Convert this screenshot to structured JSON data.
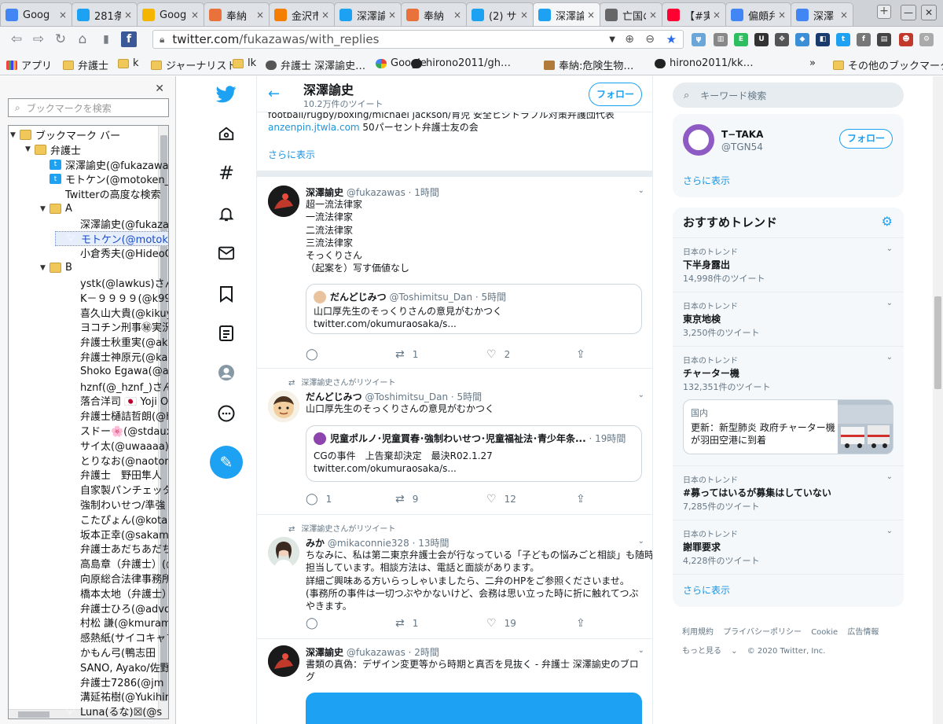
{
  "browser": {
    "tabs": [
      {
        "label": "Goog",
        "icon": "gmail-icon",
        "color": "#4285f4"
      },
      {
        "label": "281条",
        "icon": "twitter-icon",
        "color": "#1da1f2"
      },
      {
        "label": "Goog",
        "icon": "keep-icon",
        "color": "#f4b400"
      },
      {
        "label": "奉納",
        "icon": "blog-icon",
        "color": "#e8713c"
      },
      {
        "label": "金沢市",
        "icon": "blogger-icon",
        "color": "#f57d00"
      },
      {
        "label": "深澤諭",
        "icon": "twitter-icon",
        "color": "#1da1f2"
      },
      {
        "label": "奉納",
        "icon": "blog-icon",
        "color": "#e8713c"
      },
      {
        "label": "(2) サ",
        "icon": "twitter-icon",
        "color": "#1da1f2"
      },
      {
        "label": "深澤論",
        "icon": "twitter-icon",
        "color": "#1da1f2"
      },
      {
        "label": "亡国の",
        "icon": "globe-icon",
        "color": "#666666"
      },
      {
        "label": "【#実",
        "icon": "yahoo-icon",
        "color": "#ff0033"
      },
      {
        "label": "偏頗弁",
        "icon": "google-icon",
        "color": "#4285f4"
      },
      {
        "label": "深澤",
        "icon": "google-icon",
        "color": "#4285f4"
      }
    ],
    "url_host": "twitter.com",
    "url_path": "/fukazawas/with_replies",
    "bookmarks_bar": [
      "アプリ",
      "弁護士",
      "k",
      "ジャーナリスト",
      "lk",
      "弁護士 深澤諭史…",
      "Google",
      "hirono2011/gh…",
      "奉納:危険生物…",
      "hirono2011/kk…",
      "»",
      "その他のブックマーク"
    ]
  },
  "sidebar": {
    "search_placeholder": "ブックマークを検索",
    "tree": [
      {
        "label": "ブックマーク バー",
        "type": "folder",
        "depth": 0,
        "open": true
      },
      {
        "label": "弁護士",
        "type": "folder",
        "depth": 1,
        "open": true
      },
      {
        "label": "深澤諭史(@fukazawas",
        "type": "tw-square",
        "depth": 2
      },
      {
        "label": "モトケン(@motoken_tw",
        "type": "tw-square",
        "depth": 2
      },
      {
        "label": "Twitterの高度な検索",
        "type": "bird",
        "depth": 2
      },
      {
        "label": "A",
        "type": "folder",
        "depth": 2,
        "open": true
      },
      {
        "label": "深澤諭史(@fukazawas",
        "type": "bird",
        "depth": 3
      },
      {
        "label": "モトケン(@motoken_tw",
        "type": "bird",
        "depth": 3,
        "selected": true
      },
      {
        "label": "小倉秀夫(@HideoOgura",
        "type": "bird",
        "depth": 3
      },
      {
        "label": "B",
        "type": "folder",
        "depth": 2,
        "open": true
      },
      {
        "label": "ystk(@lawkus)さん",
        "type": "bird",
        "depth": 3
      },
      {
        "label": "K－９９９９(@k9999",
        "type": "bird",
        "depth": 3
      },
      {
        "label": "喜久山大貴(@kikuyama",
        "type": "bird",
        "depth": 3
      },
      {
        "label": "ヨコチン刑事㊙実況",
        "type": "bird",
        "depth": 3
      },
      {
        "label": "弁護士秋重実(@aki",
        "type": "bird",
        "depth": 3
      },
      {
        "label": "弁護士神原元(@kambara",
        "type": "bird",
        "depth": 3
      },
      {
        "label": "Shoko Egawa(@amneris",
        "type": "bird",
        "depth": 3
      },
      {
        "label": "hznf(@_hznf_)さん",
        "type": "bird",
        "depth": 3
      },
      {
        "label": "落合洋司 🇯🇵 Yoji Ochiai",
        "type": "bird",
        "depth": 3
      },
      {
        "label": "弁護士樋詰哲朗(@hi",
        "type": "bird",
        "depth": 3
      },
      {
        "label": "スドー🌸(@stdaux",
        "type": "bird",
        "depth": 3
      },
      {
        "label": "サイ太(@uwaaaa)",
        "type": "bird",
        "depth": 3
      },
      {
        "label": "とりなお(@naotori",
        "type": "bird",
        "depth": 3
      },
      {
        "label": "弁護士　野田隼人",
        "type": "bird",
        "depth": 3
      },
      {
        "label": "自家製パンチェッタ",
        "type": "bird",
        "depth": 3
      },
      {
        "label": "強制わいせつ/準強",
        "type": "bird",
        "depth": 3
      },
      {
        "label": "こたぴょん(@kotapyon",
        "type": "bird",
        "depth": 3
      },
      {
        "label": "坂本正幸(@sakamoto",
        "type": "bird",
        "depth": 3
      },
      {
        "label": "弁護士あだちあだち",
        "type": "bird",
        "depth": 3
      },
      {
        "label": "高島章（弁護士）(@",
        "type": "bird",
        "depth": 3
      },
      {
        "label": "向原総合法律事務所",
        "type": "bird",
        "depth": 3
      },
      {
        "label": "橋本太地（弁護士）",
        "type": "bird",
        "depth": 3
      },
      {
        "label": "弁護士ひろ(@advo",
        "type": "bird",
        "depth": 3
      },
      {
        "label": "村松 謙(@kmuramatsu",
        "type": "bird",
        "depth": 3
      },
      {
        "label": "感熱紙(サイコキャプ",
        "type": "bird",
        "depth": 3
      },
      {
        "label": "かもん弓(鴨志田",
        "type": "bird",
        "depth": 3
      },
      {
        "label": "SANO, Ayako/佐野",
        "type": "bird",
        "depth": 3
      },
      {
        "label": "弁護士7286(@jm",
        "type": "bird",
        "depth": 3
      },
      {
        "label": "溝延祐樹(@Yukihiro",
        "type": "bird",
        "depth": 3
      },
      {
        "label": "Luna(るな)☒(@s",
        "type": "bird",
        "depth": 3
      }
    ]
  },
  "twitter": {
    "profile_name": "深澤諭史",
    "tweet_count": "10.2万件のツイート",
    "follow_label": "フォロー",
    "bio_partial": "football/rugby/boxing/michael jackson/育児 安全ヒジトラブル対策弁護団代表",
    "bio_link": "anzenpin.jtwla.com",
    "bio_tail": " 50パーセント弁護士友の会",
    "show_more": "さらに表示",
    "tweets": [
      {
        "name": "深澤諭史",
        "handle": "@fukazawas",
        "time": "· 1時間",
        "lines": [
          "超一流法律家",
          "一流法律家",
          "二流法律家",
          "三流法律家",
          "そっくりさん",
          "（起案を）写す価値なし"
        ],
        "quote": {
          "name": "だんどじみつ",
          "handle": "@Toshimitsu_Dan",
          "time": "· 5時間",
          "line1": "山口厚先生のそっくりさんの意見がむかつく",
          "line2": "twitter.com/okumuraosaka/s..."
        },
        "replies": "",
        "retweets": "1",
        "likes": "2"
      },
      {
        "retweet_label": "深澤諭史さんがリツイート",
        "name": "だんどじみつ",
        "handle": "@Toshimitsu_Dan",
        "time": "· 5時間",
        "lines": [
          "山口厚先生のそっくりさんの意見がむかつく"
        ],
        "quote": {
          "name": "児童ポルノ･児童買春･強制わいせつ･児童福祉法･青少年条...",
          "handle": "",
          "time": "· 19時間",
          "line1": "CGの事件　上告棄却決定　最決R02.1.27",
          "line2": "twitter.com/okumuraosaka/s..."
        },
        "replies": "1",
        "retweets": "9",
        "likes": "12"
      },
      {
        "retweet_label": "深澤諭史さんがリツイート",
        "name": "みか",
        "handle": "@mikaconnie328",
        "time": "· 13時間",
        "lines": [
          "ちなみに、私は第二東京弁護士会が行なっている「子どもの悩みごと相談」も随時",
          "担当しています。相談方法は、電話と面談があります。",
          "詳細ご興味ある方いらっしゃいましたら、二弁のHPをご参照くださいませ。",
          "(事務所の事件は一切つぶやかないけど、会務は思い立った時に折に触れてつぶ",
          "やきます。"
        ],
        "replies": "",
        "retweets": "1",
        "likes": "19"
      },
      {
        "name": "深澤諭史",
        "handle": "@fukazawas",
        "time": "· 2時間",
        "lines": [
          "書類の真偽：デザイン変更等から時期と真否を見抜く - 弁護士 深澤諭史のブロ",
          "グ"
        ]
      }
    ],
    "search_placeholder": "キーワード検索",
    "suggest": {
      "name": "T−TAKA",
      "handle": "@TGN54",
      "follow": "フォロー",
      "more": "さらに表示"
    },
    "trends_title": "おすすめトレンド",
    "trends": [
      {
        "category": "日本のトレンド",
        "title": "下半身露出",
        "count": "14,998件のツイート"
      },
      {
        "category": "日本のトレンド",
        "title": "東京地検",
        "count": "3,250件のツイート"
      },
      {
        "category": "日本のトレンド",
        "title": "チャーター機",
        "count": "132,351件のツイート"
      },
      {
        "category": "日本のトレンド",
        "title": "#募ってはいるが募集はしていない",
        "count": "7,285件のツイート"
      },
      {
        "category": "日本のトレンド",
        "title": "謝罪要求",
        "count": "4,228件のツイート"
      }
    ],
    "news": {
      "category": "国内",
      "line1": "更新：新型肺炎 政府チャーター機",
      "line2": "が羽田空港に到着"
    },
    "trends_more": "さらに表示",
    "footer": [
      "利用規約",
      "プライバシーポリシー",
      "Cookie",
      "広告情報"
    ],
    "footer_more": "もっと見る",
    "copyright": "© 2020 Twitter, Inc."
  }
}
